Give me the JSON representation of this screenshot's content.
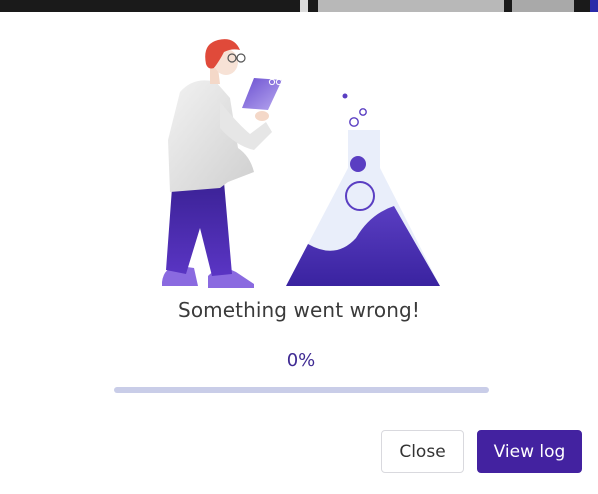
{
  "dialog": {
    "message": "Something went wrong!",
    "progress_label": "0%",
    "progress_value": 0,
    "close_label": "Close",
    "view_log_label": "View log"
  },
  "illustration": {
    "icon": "scientist-with-flask-illustration"
  },
  "colors": {
    "accent": "#4322a0",
    "progress_track": "#c9cde8",
    "text": "#3a3a3a",
    "flask_fill": "#4a2fa0",
    "hair": "#e04a3a"
  }
}
